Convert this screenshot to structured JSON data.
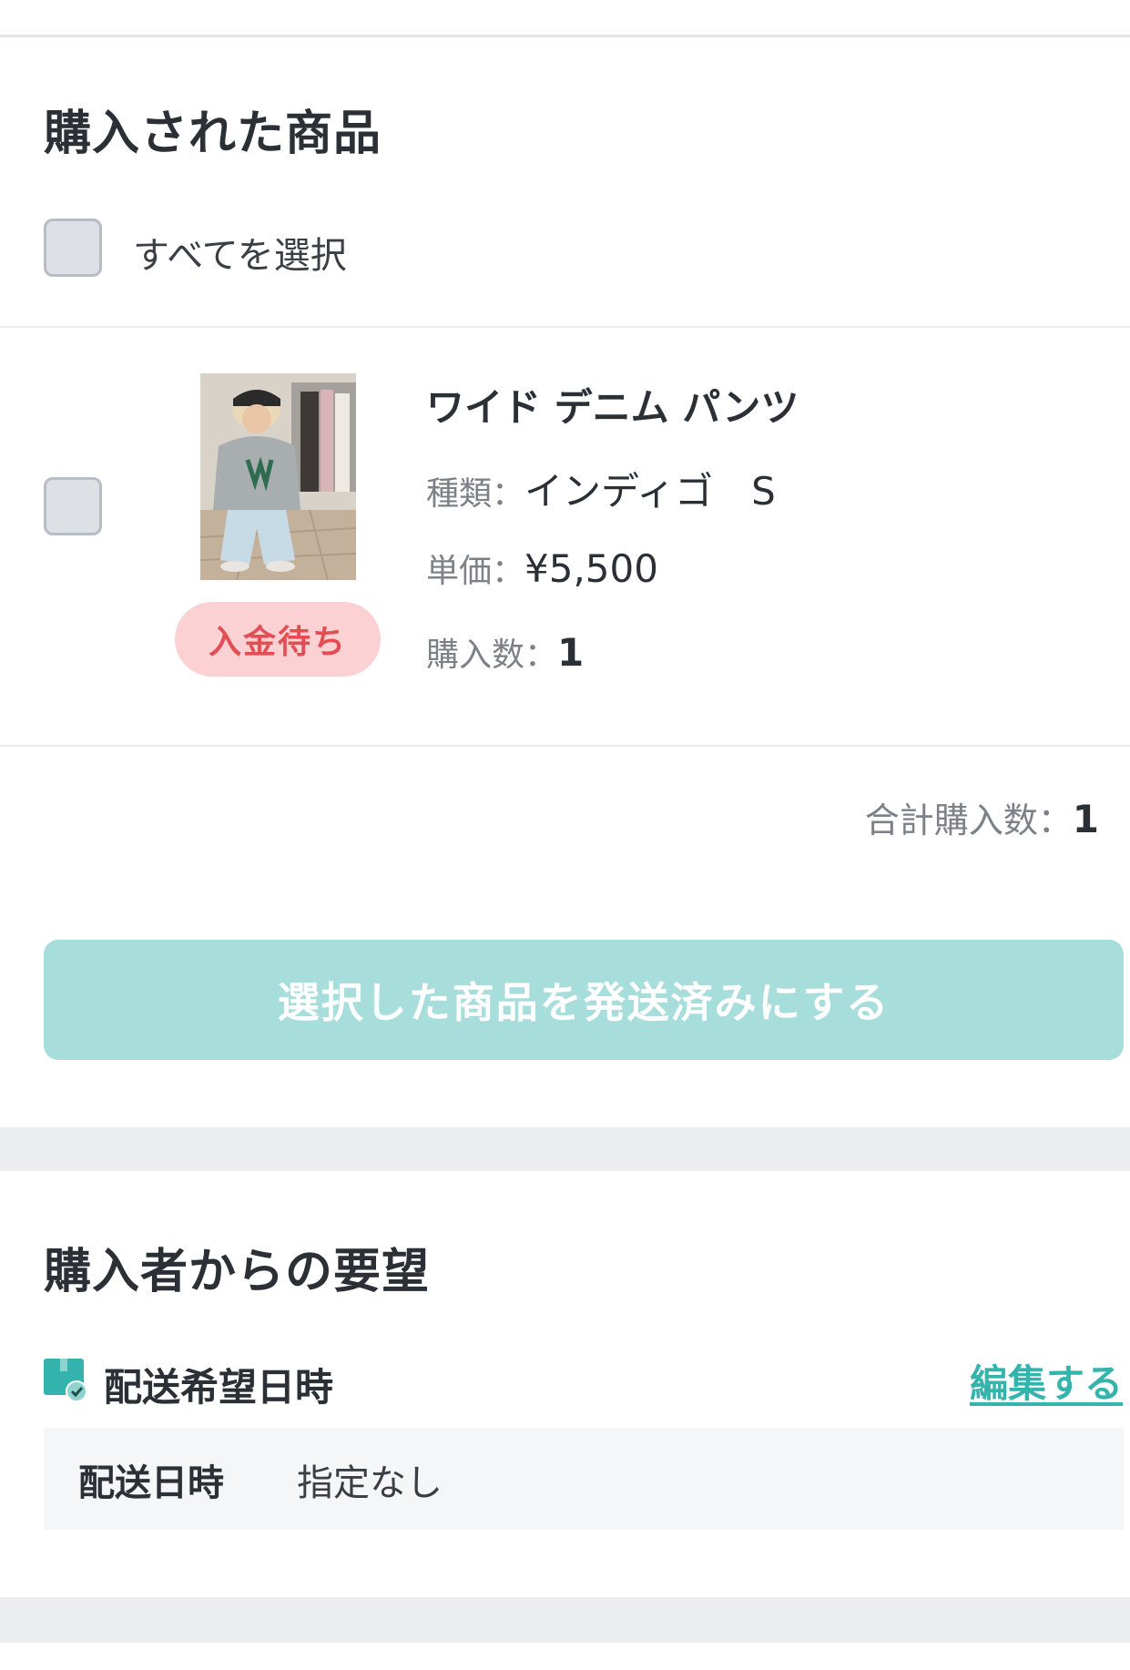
{
  "purchased_section": {
    "title": "購入された商品",
    "select_all_label": "すべてを選択"
  },
  "item": {
    "name": "ワイド デニム パンツ",
    "type_label": "種類：",
    "type_value": "インディゴ　S",
    "price_label": "単価：",
    "price_value": "¥5,500",
    "qty_label": "購入数：",
    "qty_value": "1",
    "status_badge": "入金待ち"
  },
  "summary": {
    "total_label": "合計購入数：",
    "total_value": "1"
  },
  "mark_shipped_button": "選択した商品を発送済みにする",
  "requests_section": {
    "title": "購入者からの要望",
    "delivery_pref_label": "配送希望日時",
    "edit_link": "編集する",
    "row_key": "配送日時",
    "row_value": "指定なし"
  },
  "colors": {
    "accent_teal": "#35b3ad",
    "button_teal_disabled": "#a7dedc",
    "status_pink_bg": "#fbd1d3",
    "status_red_text": "#e24e53"
  },
  "icons": {
    "delivery": "delivery-box-check-icon"
  }
}
